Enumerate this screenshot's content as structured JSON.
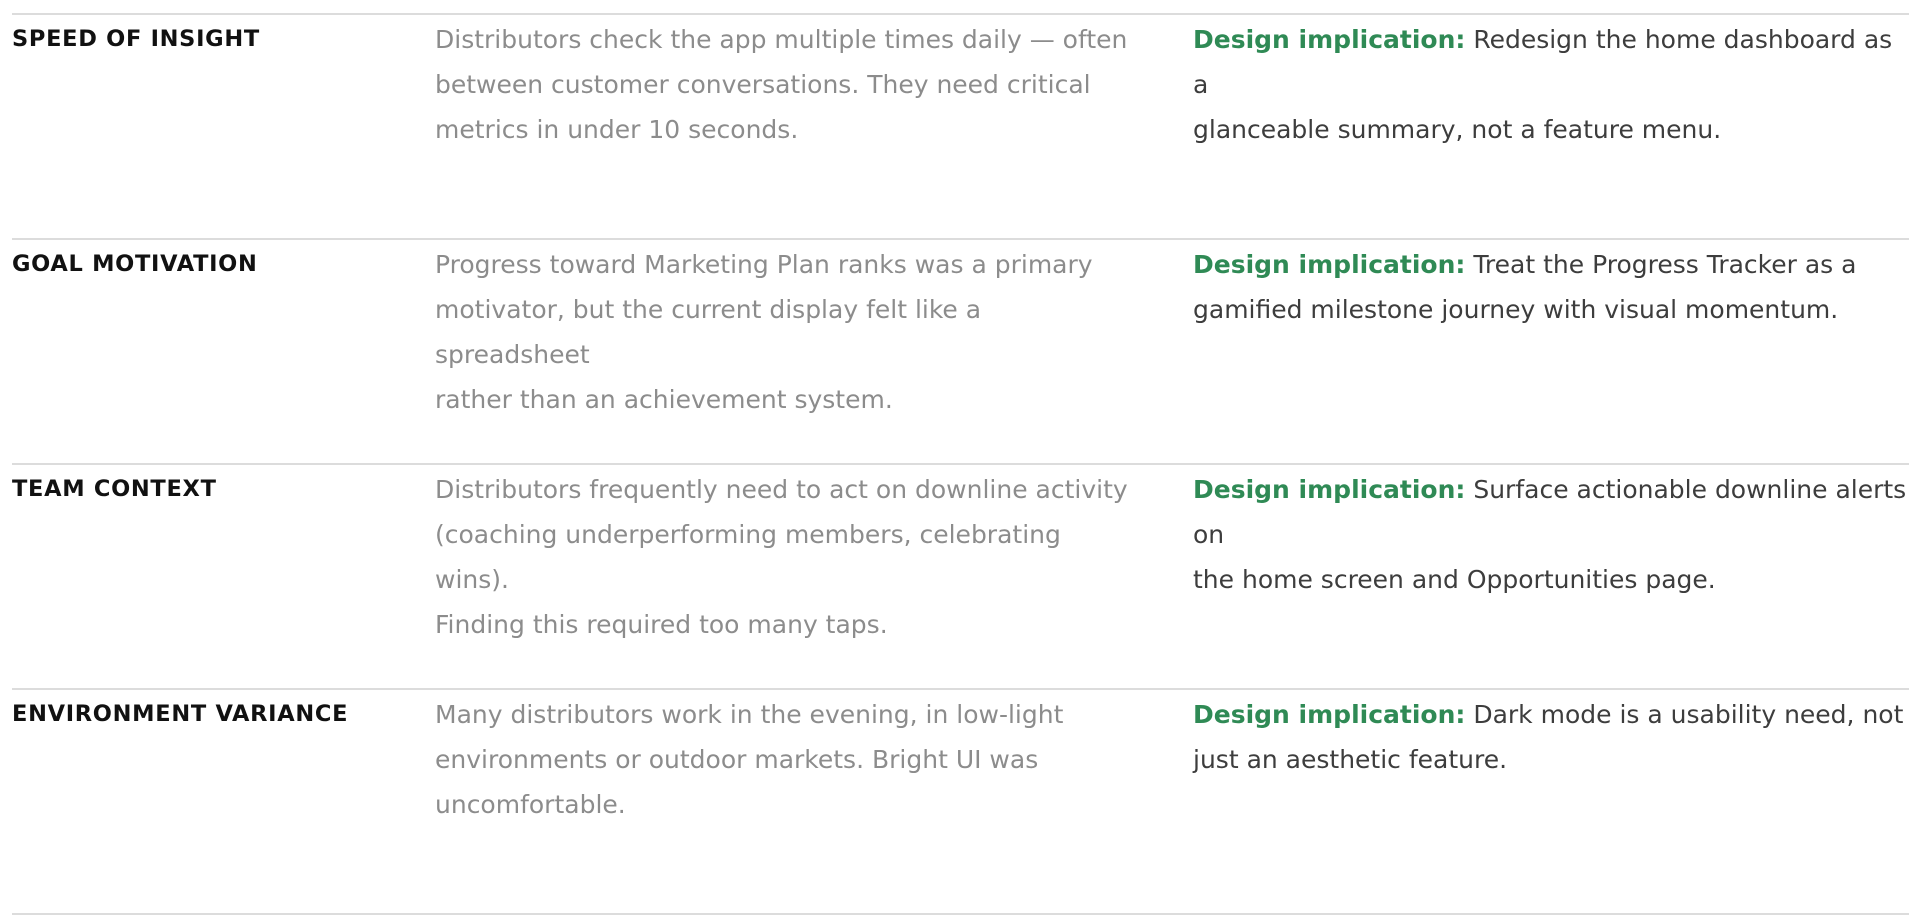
{
  "colors": {
    "label": "#111111",
    "finding_text": "#8c8c8c",
    "implication_text": "#3d3d3d",
    "implication_prefix": "#2f8a55",
    "divider": "#dcdcdc"
  },
  "rows": [
    {
      "label": "SPEED OF INSIGHT",
      "finding": "Distributors check the app multiple times daily — often\nbetween customer conversations. They need critical\nmetrics in under 10 seconds.",
      "implication_prefix": "Design implication:",
      "implication": " Redesign the home dashboard as a\nglanceable summary, not a feature menu."
    },
    {
      "label": "GOAL MOTIVATION",
      "finding": "Progress toward Marketing Plan ranks was a primary\nmotivator, but the current display felt like a spreadsheet\nrather than an achievement system.",
      "implication_prefix": "Design implication:",
      "implication": " Treat the Progress Tracker as a\ngamified milestone journey with visual momentum."
    },
    {
      "label": "TEAM CONTEXT",
      "finding": "Distributors frequently need to act on downline activity\n(coaching underperforming members, celebrating wins).\nFinding this required too many taps.",
      "implication_prefix": "Design implication:",
      "implication": " Surface actionable downline alerts on\nthe home screen and Opportunities page."
    },
    {
      "label": "ENVIRONMENT VARIANCE",
      "finding": "Many distributors work in the evening, in low-light\nenvironments or outdoor markets. Bright UI was\nuncomfortable.",
      "implication_prefix": "Design implication:",
      "implication": " Dark mode is a usability need, not\njust an aesthetic feature."
    }
  ]
}
